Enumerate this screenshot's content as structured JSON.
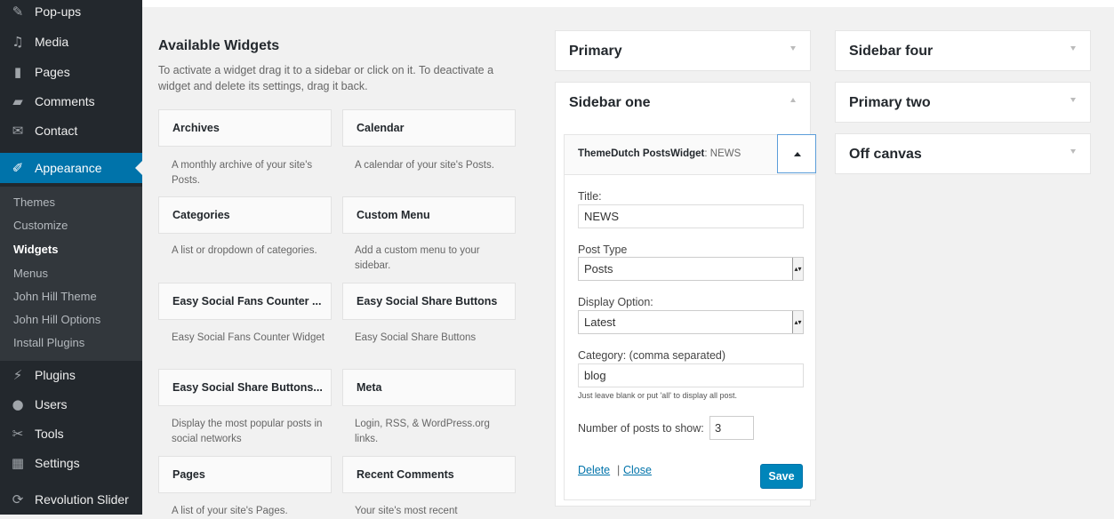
{
  "admin_menu": {
    "popups": "Pop-ups",
    "media": "Media",
    "pages": "Pages",
    "comments": "Comments",
    "contact": "Contact",
    "appearance": "Appearance",
    "plugins": "Plugins",
    "users": "Users",
    "tools": "Tools",
    "settings": "Settings",
    "revolution_slider": "Revolution Slider"
  },
  "appearance_submenu": {
    "themes": "Themes",
    "customize": "Customize",
    "widgets": "Widgets",
    "menus": "Menus",
    "john_hill_theme": "John Hill Theme",
    "john_hill_options": "John Hill Options",
    "install_plugins": "Install Plugins"
  },
  "available_widgets": {
    "title": "Available Widgets",
    "description": "To activate a widget drag it to a sidebar or click on it. To deactivate a widget and delete its settings, drag it back.",
    "widgets": [
      {
        "name": "Archives",
        "desc": "A monthly archive of your site's Posts."
      },
      {
        "name": "Calendar",
        "desc": "A calendar of your site's Posts."
      },
      {
        "name": "Categories",
        "desc": "A list or dropdown of categories."
      },
      {
        "name": "Custom Menu",
        "desc": "Add a custom menu to your sidebar."
      },
      {
        "name": "Easy Social Fans Counter ...",
        "desc": "Easy Social Fans Counter Widget"
      },
      {
        "name": "Easy Social Share Buttons",
        "desc": "Easy Social Share Buttons"
      },
      {
        "name": "Easy Social Share Buttons...",
        "desc": "Display the most popular posts in social networks"
      },
      {
        "name": "Meta",
        "desc": "Login, RSS, & WordPress.org links."
      },
      {
        "name": "Pages",
        "desc": "A list of your site's Pages."
      },
      {
        "name": "Recent Comments",
        "desc": "Your site's most recent"
      }
    ]
  },
  "sidebar_areas": {
    "primary": "Primary",
    "sidebar_one": "Sidebar one",
    "sidebar_four": "Sidebar four",
    "primary_two": "Primary two",
    "off_canvas": "Off canvas"
  },
  "widget_form": {
    "title_main": "ThemeDutch PostsWidget",
    "title_sub": ": NEWS",
    "title_label": "Title:",
    "title_value": "NEWS",
    "post_type_label": "Post Type",
    "post_type_value": "Posts",
    "display_label": "Display Option:",
    "display_value": "Latest",
    "category_label": "Category: (comma separated)",
    "category_value": "blog",
    "category_hint": "Just leave blank or put 'all' to display all post.",
    "num_label": "Number of posts to show:",
    "num_value": "3",
    "delete_label": "Delete",
    "separator": "|",
    "close_label": "Close",
    "save_label": "Save"
  },
  "colors": {
    "sidebar_bg": "#23282d",
    "accent": "#0073aa",
    "button": "#0085ba"
  }
}
